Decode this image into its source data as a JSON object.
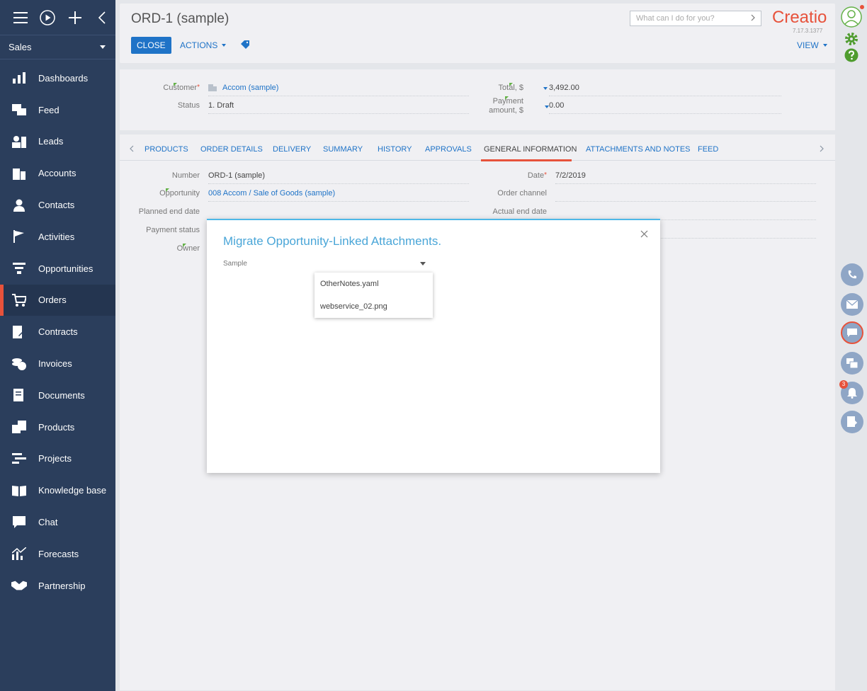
{
  "sidebar": {
    "workplace": "Sales",
    "items": [
      {
        "label": "Dashboards",
        "icon": "dashboards-icon"
      },
      {
        "label": "Feed",
        "icon": "feed-icon"
      },
      {
        "label": "Leads",
        "icon": "leads-icon"
      },
      {
        "label": "Accounts",
        "icon": "accounts-icon"
      },
      {
        "label": "Contacts",
        "icon": "contacts-icon"
      },
      {
        "label": "Activities",
        "icon": "activities-icon"
      },
      {
        "label": "Opportunities",
        "icon": "opportunities-icon"
      },
      {
        "label": "Orders",
        "icon": "orders-icon",
        "active": true
      },
      {
        "label": "Contracts",
        "icon": "contracts-icon"
      },
      {
        "label": "Invoices",
        "icon": "invoices-icon"
      },
      {
        "label": "Documents",
        "icon": "documents-icon"
      },
      {
        "label": "Products",
        "icon": "products-icon"
      },
      {
        "label": "Projects",
        "icon": "projects-icon"
      },
      {
        "label": "Knowledge base",
        "icon": "knowledge-base-icon"
      },
      {
        "label": "Chat",
        "icon": "chat-icon"
      },
      {
        "label": "Forecasts",
        "icon": "forecasts-icon"
      },
      {
        "label": "Partnership",
        "icon": "partnership-icon"
      }
    ]
  },
  "header": {
    "title": "ORD-1 (sample)",
    "close_label": "CLOSE",
    "actions_label": "ACTIONS",
    "view_label": "VIEW",
    "search_placeholder": "What can I do for you?",
    "logo": "Creatio",
    "version": "7.17.3.1377"
  },
  "summary": {
    "customer_label": "Customer",
    "customer_value": "Accom (sample)",
    "status_label": "Status",
    "status_value": "1. Draft",
    "total_label": "Total, $",
    "total_value": "3,492.00",
    "payment_label_1": "Payment",
    "payment_label_2": "amount, $",
    "payment_value": "0.00"
  },
  "tabs": [
    "PRODUCTS",
    "ORDER DETAILS",
    "DELIVERY",
    "SUMMARY",
    "HISTORY",
    "APPROVALS",
    "GENERAL INFORMATION",
    "ATTACHMENTS AND NOTES",
    "FEED"
  ],
  "active_tab": "GENERAL INFORMATION",
  "general": {
    "number_label": "Number",
    "number_value": "ORD-1 (sample)",
    "opportunity_label": "Opportunity",
    "opportunity_value": "008 Accom / Sale of Goods (sample)",
    "planned_end_label": "Planned end date",
    "payment_status_label": "Payment status",
    "owner_label": "Owner",
    "date_label": "Date",
    "date_value": "7/2/2019",
    "order_channel_label": "Order channel",
    "actual_end_label": "Actual end date"
  },
  "modal": {
    "title": "Migrate Opportunity-Linked Attachments.",
    "field_label": "Sample",
    "options": [
      "OtherNotes.yaml",
      "webservice_02.png"
    ]
  },
  "rightbar": {
    "notification_count": "3"
  },
  "colors": {
    "sidebar": "#2b3e5c",
    "accent": "#e7523b",
    "link": "#1f73c7",
    "modal_title": "#4aa6d8"
  }
}
